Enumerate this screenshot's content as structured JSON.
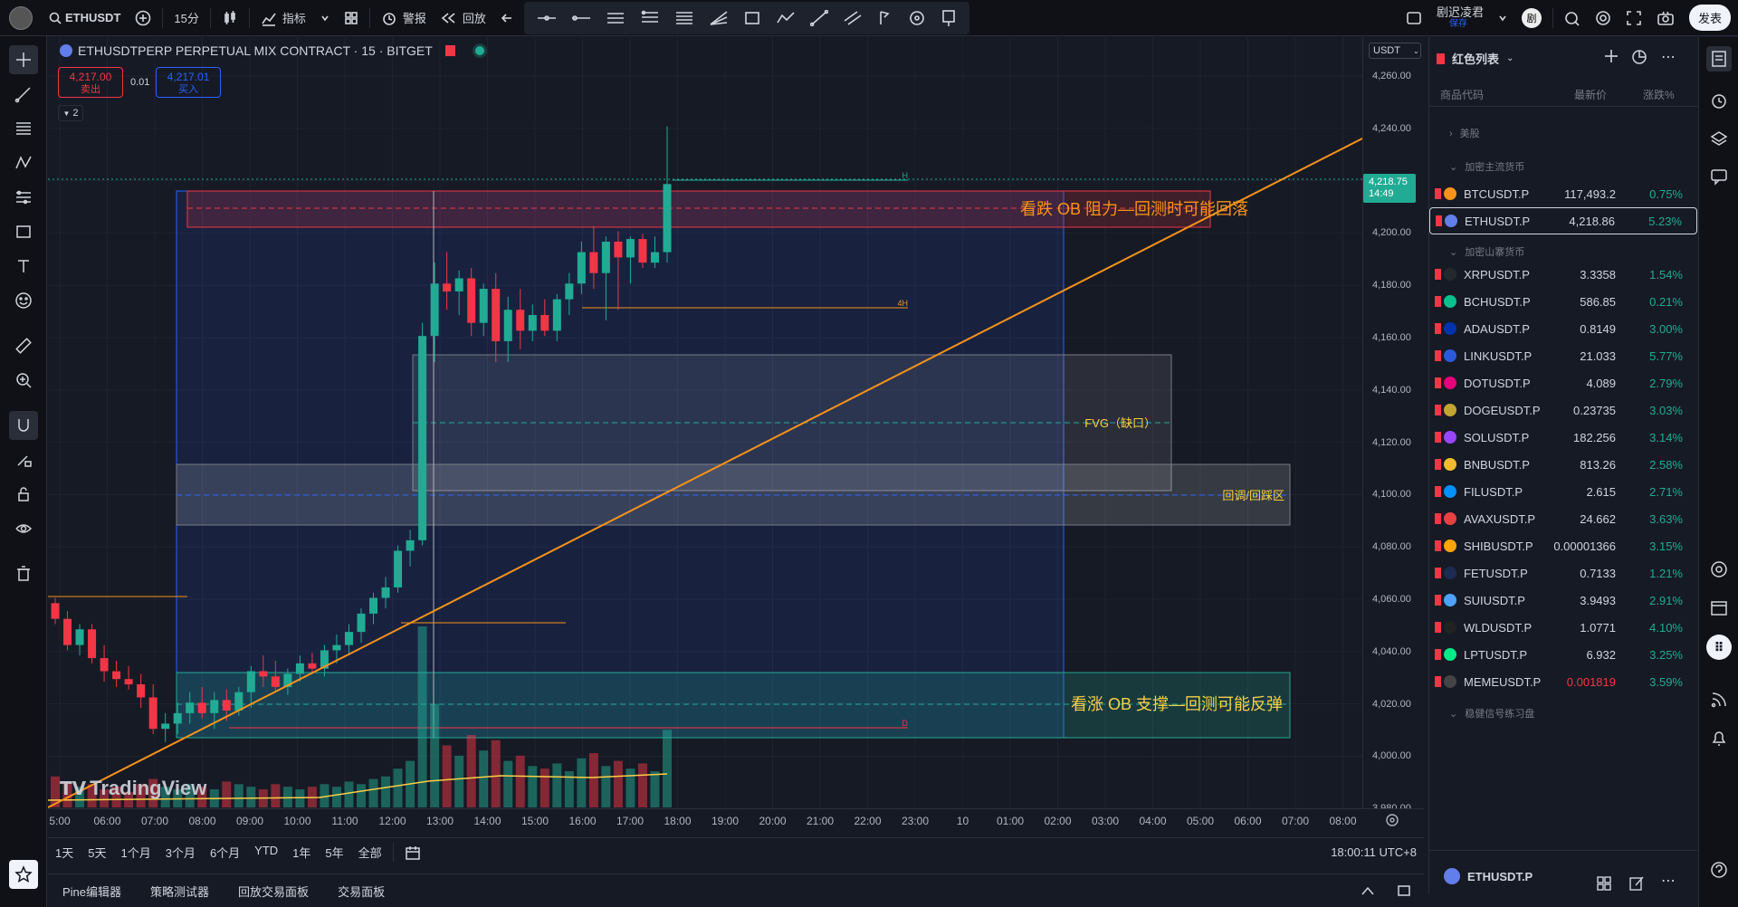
{
  "topbar": {
    "symbol": "ETHUSDT",
    "interval": "15分",
    "indicators": "指标",
    "alert": "警报",
    "replay": "回放",
    "layout_name": "剧迟凌君",
    "layout_sub": "保存",
    "avatar": "剧",
    "publish": "发表"
  },
  "legend": {
    "title": "ETHUSDTPERP PERPETUAL MIX CONTRACT · 15 · BITGET",
    "sell_price": "4,217.00",
    "sell_label": "卖出",
    "spread": "0.01",
    "buy_price": "4,217.01",
    "buy_label": "买入",
    "indicator_count": "2"
  },
  "chart": {
    "currency": "USDT",
    "price_ticks": [
      "4,260.00",
      "4,240.00",
      "4,220.00",
      "4,200.00",
      "4,180.00",
      "4,160.00",
      "4,140.00",
      "4,120.00",
      "4,100.00",
      "4,080.00",
      "4,060.00",
      "4,040.00",
      "4,020.00",
      "4,000.00",
      "3,980.00"
    ],
    "current_price": "4,218.75",
    "countdown": "14:49",
    "time_ticks": [
      "5:00",
      "06:00",
      "07:00",
      "08:00",
      "09:00",
      "10:00",
      "11:00",
      "12:00",
      "13:00",
      "14:00",
      "15:00",
      "16:00",
      "17:00",
      "18:00",
      "19:00",
      "20:00",
      "21:00",
      "22:00",
      "23:00",
      "10",
      "01:00",
      "02:00",
      "03:00",
      "04:00",
      "05:00",
      "06:00",
      "07:00",
      "08:00"
    ],
    "annotations": {
      "bear_ob": "看跌 OB 阻力—回测时可能回落",
      "fvg": "FVG（缺口）",
      "pullback": "回调/回踩区",
      "bull_ob": "看涨 OB 支撑—回测可能反弹",
      "h": "H",
      "4h": "4H",
      "d": "D"
    },
    "watermark": "TradingView",
    "colors": {
      "up": "#22ab94",
      "down": "#f23645",
      "trend": "#f7931a"
    }
  },
  "chart_data": {
    "type": "candlestick",
    "ylim": [
      3980,
      4262
    ],
    "candles": [
      [
        4058,
        4060,
        4050,
        4052
      ],
      [
        4052,
        4055,
        4040,
        4042
      ],
      [
        4042,
        4050,
        4038,
        4048
      ],
      [
        4048,
        4050,
        4035,
        4037
      ],
      [
        4037,
        4042,
        4028,
        4032
      ],
      [
        4032,
        4036,
        4026,
        4029
      ],
      [
        4029,
        4034,
        4025,
        4027
      ],
      [
        4027,
        4031,
        4018,
        4022
      ],
      [
        4022,
        4027,
        4008,
        4010
      ],
      [
        4010,
        4016,
        4005,
        4012
      ],
      [
        4012,
        4020,
        4008,
        4016
      ],
      [
        4016,
        4024,
        4012,
        4020
      ],
      [
        4020,
        4026,
        4014,
        4016
      ],
      [
        4016,
        4024,
        4010,
        4021
      ],
      [
        4021,
        4025,
        4013,
        4017
      ],
      [
        4017,
        4026,
        4015,
        4024
      ],
      [
        4024,
        4034,
        4018,
        4032
      ],
      [
        4032,
        4038,
        4026,
        4030
      ],
      [
        4030,
        4036,
        4024,
        4026
      ],
      [
        4026,
        4033,
        4023,
        4031
      ],
      [
        4031,
        4038,
        4028,
        4035
      ],
      [
        4035,
        4039,
        4031,
        4033
      ],
      [
        4033,
        4042,
        4030,
        4040
      ],
      [
        4040,
        4046,
        4035,
        4042
      ],
      [
        4042,
        4050,
        4038,
        4047
      ],
      [
        4047,
        4056,
        4043,
        4054
      ],
      [
        4054,
        4062,
        4050,
        4060
      ],
      [
        4060,
        4068,
        4056,
        4064
      ],
      [
        4064,
        4080,
        4062,
        4078
      ],
      [
        4078,
        4086,
        4072,
        4082
      ],
      [
        4082,
        4165,
        4080,
        4160
      ],
      [
        4160,
        4188,
        4150,
        4180
      ],
      [
        4180,
        4192,
        4170,
        4177
      ],
      [
        4177,
        4185,
        4168,
        4182
      ],
      [
        4182,
        4186,
        4160,
        4165
      ],
      [
        4165,
        4180,
        4160,
        4178
      ],
      [
        4178,
        4184,
        4150,
        4158
      ],
      [
        4158,
        4175,
        4150,
        4170
      ],
      [
        4170,
        4178,
        4155,
        4162
      ],
      [
        4162,
        4172,
        4158,
        4168
      ],
      [
        4168,
        4174,
        4160,
        4162
      ],
      [
        4162,
        4176,
        4158,
        4174
      ],
      [
        4174,
        4184,
        4168,
        4180
      ],
      [
        4180,
        4196,
        4176,
        4192
      ],
      [
        4192,
        4202,
        4178,
        4184
      ],
      [
        4184,
        4198,
        4166,
        4196
      ],
      [
        4196,
        4200,
        4170,
        4190
      ],
      [
        4190,
        4198,
        4180,
        4197
      ],
      [
        4197,
        4199,
        4186,
        4188
      ],
      [
        4188,
        4198,
        4186,
        4192
      ],
      [
        4192,
        4240,
        4188,
        4218
      ]
    ],
    "volume": [
      12,
      10,
      8,
      9,
      7,
      8,
      6,
      9,
      11,
      8,
      7,
      9,
      8,
      7,
      10,
      9,
      8,
      7,
      9,
      8,
      7,
      8,
      9,
      8,
      10,
      9,
      11,
      12,
      15,
      18,
      70,
      40,
      24,
      20,
      28,
      22,
      26,
      18,
      20,
      16,
      15,
      17,
      14,
      19,
      21,
      16,
      18,
      15,
      17,
      14,
      30
    ],
    "series": [
      {
        "name": "ETHUSDT.P",
        "type": "candlestick"
      }
    ]
  },
  "range": {
    "items": [
      "1天",
      "5天",
      "1个月",
      "3个月",
      "6个月",
      "YTD",
      "1年",
      "5年",
      "全部"
    ],
    "clock": "18:00:11 UTC+8"
  },
  "bottom": {
    "tabs": [
      "Pine编辑器",
      "策略测试器",
      "回放交易面板",
      "交易面板"
    ]
  },
  "watchlist": {
    "title": "红色列表",
    "col_symbol": "商品代码",
    "col_price": "最新价",
    "col_change": "涨跌%",
    "group1": "美股",
    "group2": "加密主流货币",
    "group3": "加密山寨货币",
    "group4": "稳健信号练习盘",
    "rows": [
      {
        "sym": "BTCUSDT.P",
        "price": "117,493.2",
        "chg": "0.75%",
        "color": "#f7931a"
      },
      {
        "sym": "ETHUSDT.P",
        "price": "4,218.86",
        "chg": "5.23%",
        "color": "#627eea"
      },
      {
        "sym": "XRPUSDT.P",
        "price": "3.3358",
        "chg": "1.54%",
        "color": "#23292f"
      },
      {
        "sym": "BCHUSDT.P",
        "price": "586.85",
        "chg": "0.21%",
        "color": "#0ac18e"
      },
      {
        "sym": "ADAUSDT.P",
        "price": "0.8149",
        "chg": "3.00%",
        "color": "#0033ad"
      },
      {
        "sym": "LINKUSDT.P",
        "price": "21.033",
        "chg": "5.77%",
        "color": "#2a5ada"
      },
      {
        "sym": "DOTUSDT.P",
        "price": "4.089",
        "chg": "2.79%",
        "color": "#e6007a"
      },
      {
        "sym": "DOGEUSDT.P",
        "price": "0.23735",
        "chg": "3.03%",
        "color": "#c2a633"
      },
      {
        "sym": "SOLUSDT.P",
        "price": "182.256",
        "chg": "3.14%",
        "color": "#9945ff"
      },
      {
        "sym": "BNBUSDT.P",
        "price": "813.26",
        "chg": "2.58%",
        "color": "#f3ba2f"
      },
      {
        "sym": "FILUSDT.P",
        "price": "2.615",
        "chg": "2.71%",
        "color": "#0090ff"
      },
      {
        "sym": "AVAXUSDT.P",
        "price": "24.662",
        "chg": "3.63%",
        "color": "#e84142"
      },
      {
        "sym": "SHIBUSDT.P",
        "price": "0.00001366",
        "chg": "3.15%",
        "color": "#ffa409"
      },
      {
        "sym": "FETUSDT.P",
        "price": "0.7133",
        "chg": "1.21%",
        "color": "#1d2b53"
      },
      {
        "sym": "SUIUSDT.P",
        "price": "3.9493",
        "chg": "2.91%",
        "color": "#4da2ff"
      },
      {
        "sym": "WLDUSDT.P",
        "price": "1.0771",
        "chg": "4.10%",
        "color": "#222222"
      },
      {
        "sym": "LPTUSDT.P",
        "price": "6.932",
        "chg": "3.25%",
        "color": "#00eb88"
      },
      {
        "sym": "MEMEUSDT.P",
        "price": "0.001819",
        "chg": "3.59%",
        "color": "#444444",
        "price_color": "#f23645"
      }
    ],
    "footer_symbol": "ETHUSDT.P"
  }
}
